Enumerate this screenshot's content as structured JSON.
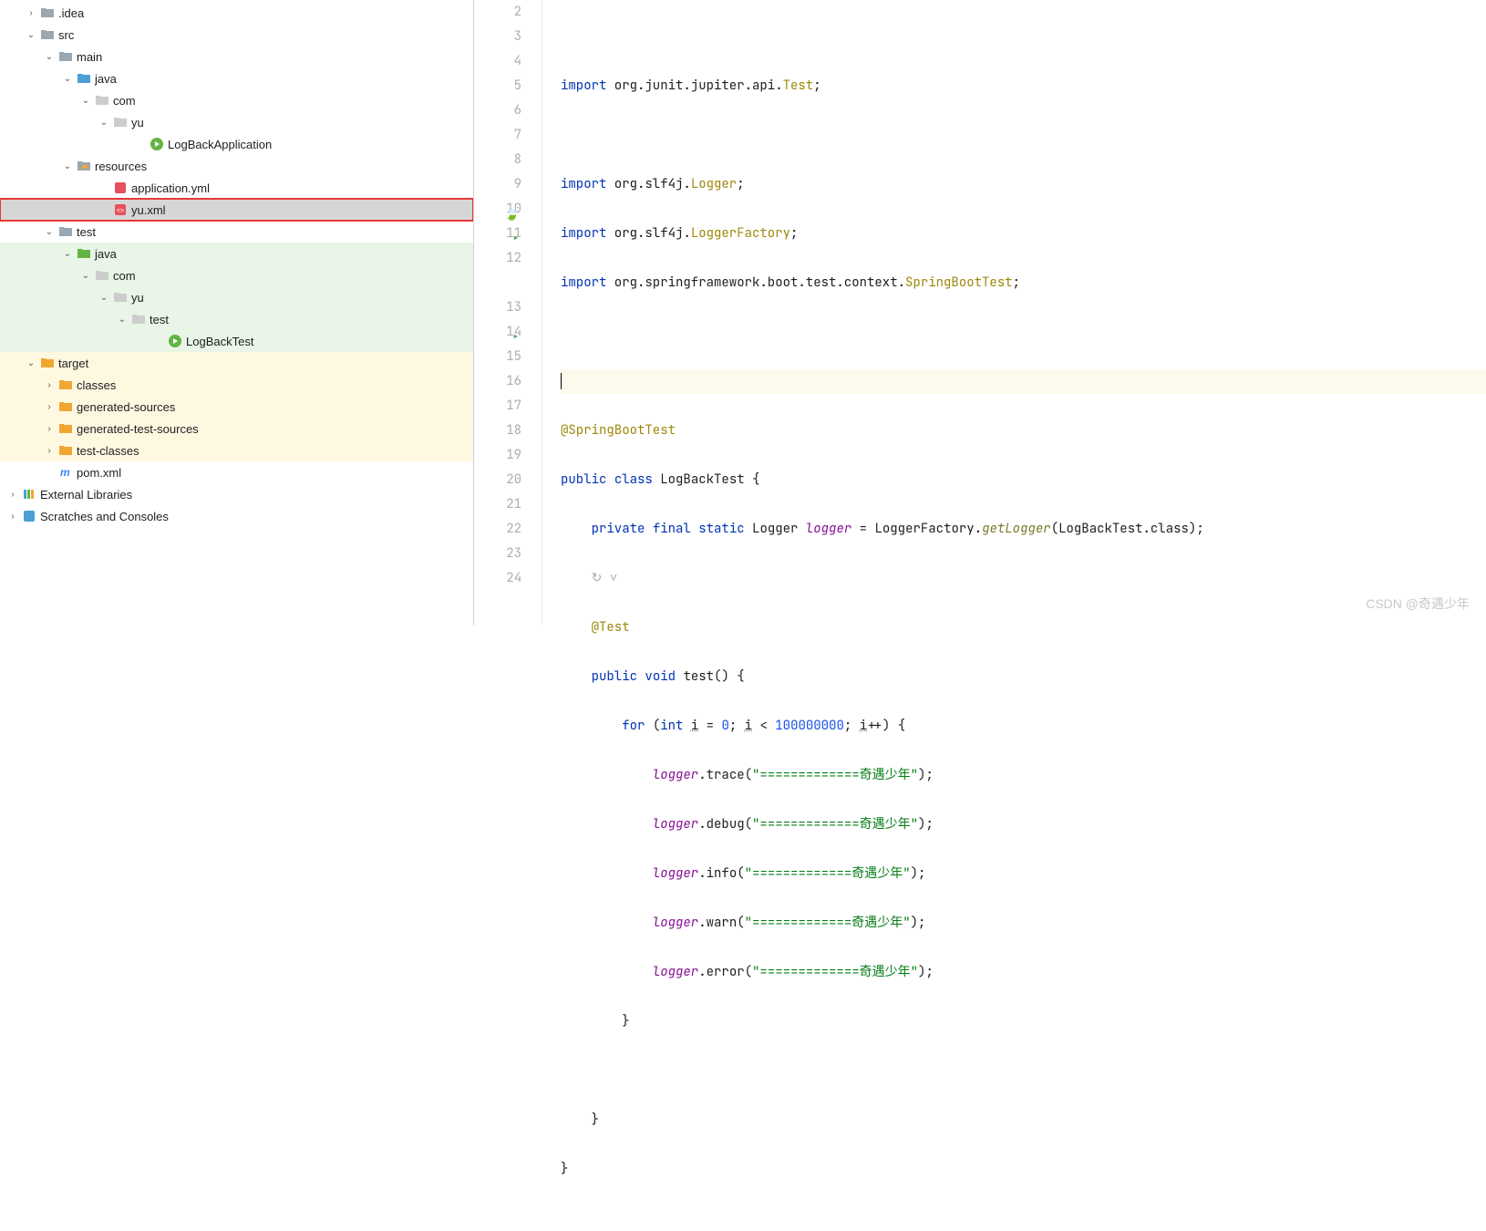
{
  "tree": {
    "idea": ".idea",
    "src": "src",
    "main": "main",
    "java1": "java",
    "com1": "com",
    "yu1": "yu",
    "logbackapp": "LogBackApplication",
    "resources": "resources",
    "appyml": "application.yml",
    "yuxml": "yu.xml",
    "test": "test",
    "java2": "java",
    "com2": "com",
    "yu2": "yu",
    "test2": "test",
    "logbacktest": "LogBackTest",
    "target": "target",
    "classes": "classes",
    "gensrc": "generated-sources",
    "gentestsrc": "generated-test-sources",
    "testclasses": "test-classes",
    "pom": "pom.xml",
    "extlib": "External Libraries",
    "scratch": "Scratches and Consoles"
  },
  "code": {
    "imp1_kw": "import",
    "imp1_pkg": " org.junit.jupiter.api.",
    "imp1_cls": "Test",
    "semi": ";",
    "imp2_pkg": " org.slf4j.",
    "imp2_cls": "Logger",
    "imp3_pkg": " org.slf4j.",
    "imp3_cls": "LoggerFactory",
    "imp4_pkg": " org.springframework.boot.test.context.",
    "imp4_cls": "SpringBootTest",
    "ann_sbt": "@SpringBootTest",
    "pub": "public",
    "cls_kw": "class",
    "voidk": "void",
    "priv": "private",
    "finl": "final",
    "stat": "static",
    "cls_name": "LogBackTest",
    "brace_o": " {",
    "brace_c": "}",
    "logger_type": "Logger",
    "logger_var": "logger",
    "eq": " = ",
    "lf": "LoggerFactory",
    "dot": ".",
    "getl": "getLogger",
    "paren_o": "(",
    "paren_c": ")",
    "clssfx": ".class",
    "ann_test": "@Test",
    "test_name": "test",
    "empty_parens": "()",
    "for_kw": "for",
    "int_kw": "int",
    "i_var": "i",
    "eq0": " = ",
    "zero": "0",
    "lt": " < ",
    "limit": "100000000",
    "inc": "++",
    "trace": "trace",
    "debug": "debug",
    "info": "info",
    "warn": "warn",
    "error": "error",
    "str_eq": "\"=============奇遇少年\"",
    "recur_icon": "↻ ˅"
  },
  "lines": [
    "2",
    "3",
    "4",
    "5",
    "6",
    "7",
    "8",
    "9",
    "10",
    "11",
    "12",
    "",
    "13",
    "14",
    "15",
    "16",
    "17",
    "18",
    "19",
    "20",
    "21",
    "22",
    "23",
    "24"
  ],
  "watermark": "CSDN @奇遇少年"
}
